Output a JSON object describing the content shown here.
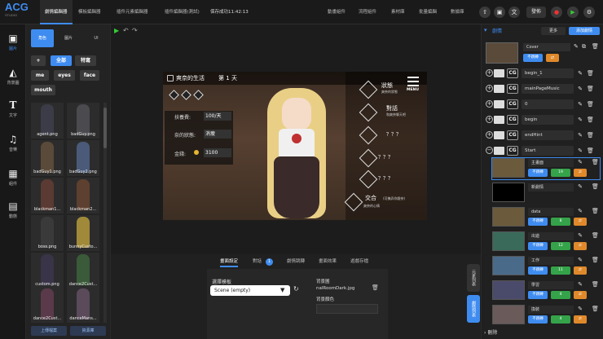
{
  "app": {
    "logo": "ACG",
    "logo_sub": "STUDIO",
    "save_status": "保存成功11:42:13"
  },
  "top_nav": [
    "劇情編輯器",
    "模板編輯器",
    "插件元素編輯器",
    "插件編輯器(測試)"
  ],
  "top_tools": [
    "動畫組件",
    "流程組件",
    "素材庫",
    "批量編輯",
    "數據庫"
  ],
  "publish_label": "發佈",
  "left_nav": [
    {
      "label": "圖片",
      "icon": "image-icon"
    },
    {
      "label": "背景圖",
      "icon": "landscape-icon"
    },
    {
      "label": "文字",
      "icon": "text-icon"
    },
    {
      "label": "音樂",
      "icon": "music-icon"
    },
    {
      "label": "組件",
      "icon": "blocks-icon"
    },
    {
      "label": "動態",
      "icon": "dynamic-icon"
    }
  ],
  "asset_tabs": [
    "角色",
    "圖片",
    "UI"
  ],
  "filter_chips": [
    "+",
    "全部",
    "特寫",
    "me",
    "eyes",
    "face",
    "mouth"
  ],
  "assets": [
    {
      "name": "agent.png",
      "color": "#3c3c48"
    },
    {
      "name": "badGuy.png",
      "color": "#4a4a4f"
    },
    {
      "name": "badGuy1.png",
      "color": "#5a4a3a"
    },
    {
      "name": "badGuy2.png",
      "color": "#4a5a78"
    },
    {
      "name": "blackman1...",
      "color": "#5a3a32"
    },
    {
      "name": "blackman2...",
      "color": "#5d4030"
    },
    {
      "name": "boss.png",
      "color": "#3a3a3a"
    },
    {
      "name": "bunnyCusto...",
      "color": "#a08a3a"
    },
    {
      "name": "custom.png",
      "color": "#3a3448"
    },
    {
      "name": "dance2Cust...",
      "color": "#3a5a3a"
    },
    {
      "name": "dance2Cust...",
      "color": "#5a3a4a"
    },
    {
      "name": "danceMans...",
      "color": "#5a4a5a"
    }
  ],
  "asset_buttons": [
    "上傳檔案",
    "資源庫"
  ],
  "game": {
    "title": "爽奈的生活",
    "day_prefix": "第",
    "day": "1",
    "day_suffix": "天",
    "stats": [
      {
        "label": "扶養費:",
        "value": "100/天"
      },
      {
        "label": "奈的狀態:",
        "value": "消瘦"
      },
      {
        "label": "金錢:",
        "value": "3100"
      }
    ],
    "menu_label": "MENU",
    "menu": [
      {
        "title": "狀態",
        "sub": "爽奈的狀態"
      },
      {
        "title": "對話",
        "sub": "和爽奈聊天吧"
      },
      {
        "title": "？？？",
        "sub": ""
      },
      {
        "title": "？？？",
        "sub": ""
      },
      {
        "title": "？？？",
        "sub": ""
      },
      {
        "title": "交合",
        "sub": "(可撫弄你跟奈)"
      },
      {
        "title": "",
        "sub": "爽奈的心情"
      }
    ]
  },
  "bottom_tabs": [
    "畫面設定",
    "對話",
    "劇情跳轉",
    "畫面效果",
    "遊戲存檔"
  ],
  "dialog_badge": "1",
  "template": {
    "label": "選擇模板",
    "value": "Scene (empty)"
  },
  "bg": {
    "label": "背景圖",
    "file": "nalRoomDark.jpg",
    "color_label": "背景顏色"
  },
  "right_header": {
    "title": "劇情",
    "search": "更多",
    "add": "添加劇情"
  },
  "chapters": [
    {
      "name": "Cover",
      "tags": [
        "不跳轉"
      ]
    },
    {
      "name": "begin_1"
    },
    {
      "name": "mainPageMusic"
    },
    {
      "name": "0"
    },
    {
      "name": "begin"
    },
    {
      "name": "endHint"
    },
    {
      "name": "Start"
    }
  ],
  "scenes": [
    {
      "name": "主畫面",
      "tag": "不跳轉",
      "count": "19",
      "bg": "#6b5a3c"
    },
    {
      "name": "新劇情",
      "tag": "",
      "count": "",
      "bg": "#000000"
    },
    {
      "name": "data",
      "tag": "不跳轉",
      "count": "8",
      "bg": "#6b5a3c"
    },
    {
      "name": "出遊",
      "tag": "不跳轉",
      "count": "12",
      "bg": "#3a6a5a"
    },
    {
      "name": "工作",
      "tag": "不跳轉",
      "count": "11",
      "bg": "#4a6a8a"
    },
    {
      "name": "學習",
      "tag": "不跳轉",
      "count": "4",
      "bg": "#4a4a6a"
    },
    {
      "name": "換裝",
      "tag": "不跳轉",
      "count": "4",
      "bg": "#6a5a5a"
    }
  ],
  "side_tabs": [
    "元素列表",
    "劇情列表"
  ],
  "footer": "刪除",
  "colors": {
    "accent": "#3f8cf0",
    "green": "#35a34a",
    "orange": "#e0892b"
  }
}
